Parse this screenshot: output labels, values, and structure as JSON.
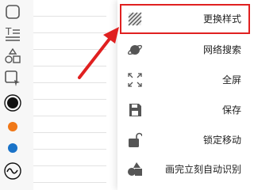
{
  "menu": {
    "items": [
      {
        "label": "更换样式",
        "icon": "hatch-pattern-icon"
      },
      {
        "label": "网络搜索",
        "icon": "planet-icon"
      },
      {
        "label": "全屏",
        "icon": "fullscreen-icon"
      },
      {
        "label": "保存",
        "icon": "save-icon"
      },
      {
        "label": "锁定移动",
        "icon": "unlock-icon"
      },
      {
        "label": "画完立刻自动识别",
        "icon": "shapes-auto-icon"
      }
    ]
  },
  "toolbar": {
    "tools": [
      "square-shape-icon",
      "text-format-icon",
      "shapes-icon",
      "select-cursor-icon",
      "color-black-selected",
      "color-orange",
      "color-blue",
      "wave-stroke-icon"
    ]
  },
  "colors": {
    "accent_highlight": "#e02020",
    "arrow": "#e02020",
    "orange": "#f07818",
    "blue": "#1a73c8",
    "black": "#111111",
    "icon_gray": "#555555"
  }
}
